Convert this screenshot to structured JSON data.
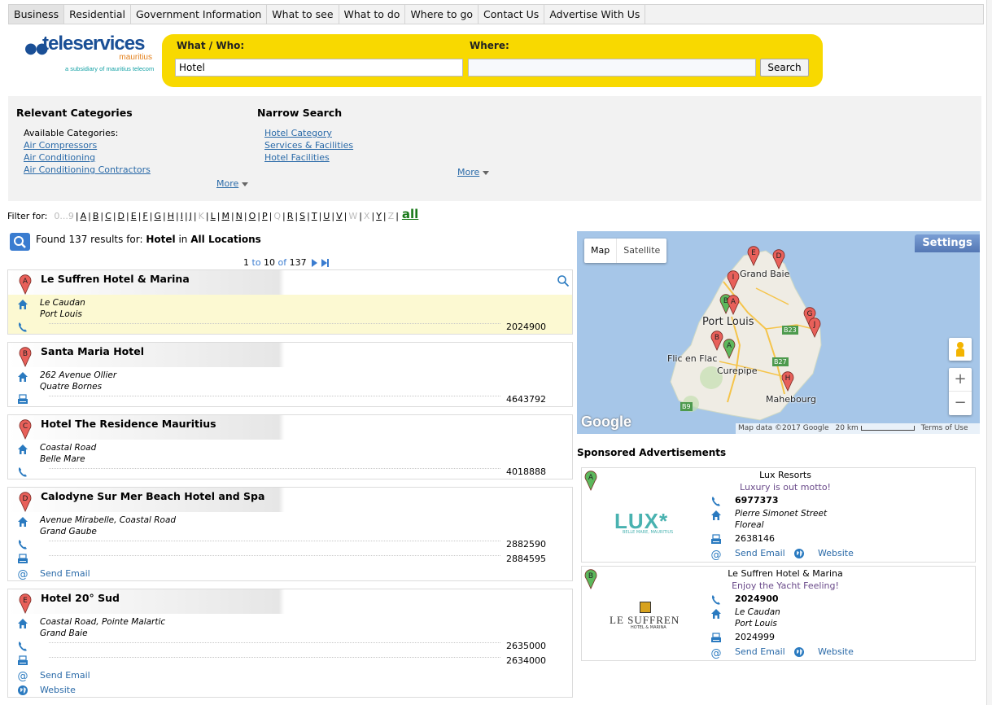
{
  "nav": {
    "tabs": [
      "Business",
      "Residential",
      "Government Information",
      "What to see",
      "What to do",
      "Where to go",
      "Contact Us",
      "Advertise With Us"
    ],
    "active_tab": "Business"
  },
  "logo": {
    "name": "teleservices",
    "sub": "mauritius",
    "tagline": "a subsidiary of mauritius telecom"
  },
  "search": {
    "what_label": "What / Who:",
    "what_value": "Hotel",
    "where_label": "Where:",
    "where_value": "",
    "button": "Search"
  },
  "categories": {
    "relevant_title": "Relevant Categories",
    "available_label": "Available Categories:",
    "items": [
      "Air Compressors",
      "Air Conditioning",
      "Air Conditioning Contractors"
    ],
    "more": "More",
    "narrow_title": "Narrow Search",
    "narrow_items": [
      "Hotel Category",
      "Services & Facilities",
      "Hotel Facilities"
    ],
    "narrow_more": "More"
  },
  "filter": {
    "label": "Filter for:",
    "letters": [
      {
        "t": "0...9",
        "d": true
      },
      {
        "t": "A",
        "d": false
      },
      {
        "t": "B",
        "d": false
      },
      {
        "t": "C",
        "d": false
      },
      {
        "t": "D",
        "d": false
      },
      {
        "t": "E",
        "d": false
      },
      {
        "t": "F",
        "d": false
      },
      {
        "t": "G",
        "d": false
      },
      {
        "t": "H",
        "d": false
      },
      {
        "t": "I",
        "d": false
      },
      {
        "t": "J",
        "d": false
      },
      {
        "t": "K",
        "d": true
      },
      {
        "t": "L",
        "d": false
      },
      {
        "t": "M",
        "d": false
      },
      {
        "t": "N",
        "d": false
      },
      {
        "t": "O",
        "d": false
      },
      {
        "t": "P",
        "d": false
      },
      {
        "t": "Q",
        "d": true
      },
      {
        "t": "R",
        "d": false
      },
      {
        "t": "S",
        "d": false
      },
      {
        "t": "T",
        "d": false
      },
      {
        "t": "U",
        "d": false
      },
      {
        "t": "V",
        "d": false
      },
      {
        "t": "W",
        "d": true
      },
      {
        "t": "X",
        "d": true
      },
      {
        "t": "Y",
        "d": false
      },
      {
        "t": "Z",
        "d": true
      }
    ],
    "all": "all"
  },
  "results": {
    "prefix": "Found 137 results for:",
    "query": "Hotel",
    "in_word": "in",
    "location": "All Locations",
    "pager": {
      "from": "1",
      "to_word": "to",
      "to": "10",
      "of_word": "of",
      "total": "137"
    }
  },
  "listings": [
    {
      "letter": "A",
      "name": "Le Suffren Hotel & Marina",
      "addr1": "Le Caudan",
      "addr2": "Port Louis",
      "phone": "2024900"
    },
    {
      "letter": "B",
      "name": "Santa Maria Hotel",
      "addr1": "262 Avenue Ollier",
      "addr2": "Quatre Bornes",
      "fax": "4643792"
    },
    {
      "letter": "C",
      "name": "Hotel The Residence Mauritius",
      "addr1": "Coastal Road",
      "addr2": "Belle Mare",
      "phone": "4018888"
    },
    {
      "letter": "D",
      "name": "Calodyne Sur Mer Beach Hotel and Spa",
      "addr1": "Avenue Mirabelle, Coastal Road",
      "addr2": "Grand Gaube",
      "phone": "2882590",
      "fax": "2884595",
      "email": "Send Email"
    },
    {
      "letter": "E",
      "name": "Hotel 20° Sud",
      "addr1": "Coastal Road, Pointe Malartic",
      "addr2": "Grand Baie",
      "phone": "2635000",
      "fax": "2634000",
      "email": "Send Email",
      "website": "Website"
    }
  ],
  "map": {
    "map_btn": "Map",
    "satellite_btn": "Satellite",
    "settings": "Settings",
    "places": [
      "Grand Baie",
      "Port Louis",
      "Flic en Flac",
      "Curepipe",
      "Mahebourg"
    ],
    "roads": [
      "B23",
      "B27",
      "B9"
    ],
    "google": "Google",
    "attribution": "Map data ©2017 Google",
    "scale": "20 km",
    "terms": "Terms of Use",
    "zoom_in": "+",
    "zoom_out": "−"
  },
  "sponsored": {
    "title": "Sponsored Advertisements",
    "ads": [
      {
        "letter": "A",
        "name": "Lux Resorts",
        "slogan": "Luxury is out motto!",
        "phone": "6977373",
        "addr1": "Pierre Simonet Street",
        "addr2": "Floreal",
        "fax": "2638146",
        "email": "Send Email",
        "website": "Website",
        "logo": "LUX*",
        "logo_sub": "BELLE MARE, MAURITIUS"
      },
      {
        "letter": "B",
        "name": "Le Suffren Hotel & Marina",
        "slogan": "Enjoy the Yacht Feeling!",
        "phone": "2024900",
        "addr1": "Le Caudan",
        "addr2": "Port Louis",
        "fax": "2024999",
        "email": "Send Email",
        "website": "Website",
        "logo": "LE SUFFREN",
        "logo_sub": "HOTEL & MARINA"
      }
    ]
  },
  "colors": {
    "accent_yellow": "#f8d900",
    "link_blue": "#2a6aa8",
    "pin_red": "#e8605a",
    "pin_green": "#5cb85c"
  }
}
